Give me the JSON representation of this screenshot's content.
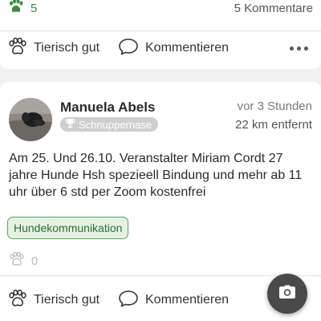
{
  "top_post": {
    "likes_count": "5",
    "comments_count": "5 Kommentare",
    "actions": {
      "like_label": "Tierisch gut",
      "comment_label": "Kommentieren"
    }
  },
  "post": {
    "author": "Manuela Abels",
    "badge": "Schnuppernase",
    "time": "vor 3 Stunden",
    "distance": "22 km entfernt",
    "text": "Am 25. Und 26.10. Veranstalter Miriam Cordt 27 jahre Hunde Hsh spezieell Bindung und mehr ab 11 uhr über 6 std per Zoom kostenfrei",
    "tag": "Hundekommunikation",
    "likes_count": "0",
    "actions": {
      "like_label": "Tierisch gut",
      "comment_label": "Kommentieren"
    }
  },
  "colors": {
    "accent_green": "#3b8a3e",
    "tag_background": "#e6f1e4",
    "fab_background": "#4a4a4a"
  },
  "icons": [
    "paw-icon",
    "paw-outline-icon",
    "comment-icon",
    "more-icon",
    "trophy-icon",
    "camera-icon"
  ]
}
